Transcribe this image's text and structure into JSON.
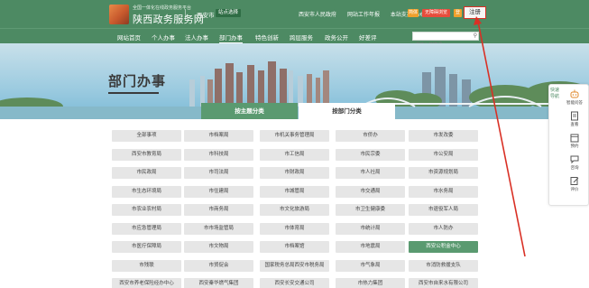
{
  "header": {
    "tagline": "全国一体化在线政务服务平台",
    "site_name": "陕西政务服务网",
    "city": "西安市",
    "switch_label": "站点选择",
    "top_links": [
      "西安市人民政府",
      "网站工作年报",
      "本站支持IPv6"
    ],
    "badge_a": "简体",
    "badge_b": "无障碍浏览",
    "badge_c": "登",
    "register_label": "注册"
  },
  "nav": {
    "items": [
      "网站首页",
      "个人办事",
      "法人办事",
      "部门办事",
      "特色创新",
      "跨层服务",
      "政务公开",
      "好差评"
    ],
    "active_index": 3,
    "search_placeholder": "请输入关键词"
  },
  "banner": {
    "title": "部门办事"
  },
  "tabs": {
    "theme": "按主题分类",
    "dept": "按部门分类",
    "active": "dept"
  },
  "categories": [
    [
      "全部事项",
      "市档案局",
      "市机关事务管理局",
      "市侨办",
      "市发改委"
    ],
    [
      "西安市教育局",
      "市科技局",
      "市工信局",
      "市民宗委",
      "市公安局"
    ],
    [
      "市民政局",
      "市司法局",
      "市财政局",
      "市人社局",
      "市资源规划局"
    ],
    [
      "市生态环境局",
      "市住建局",
      "市城管局",
      "市交通局",
      "市水务局"
    ],
    [
      "市农业农村局",
      "市商务局",
      "市文化旅游局",
      "市卫生健康委",
      "市退役军人局"
    ],
    [
      "市应急管理局",
      "市市场监管局",
      "市体育局",
      "市统计局",
      "市人防办"
    ],
    [
      "市医疗保障局",
      "市文物局",
      "市档案馆",
      "市地震局",
      "西安公积金中心"
    ],
    [
      "市残联",
      "市贸促会",
      "国家税务总局西安市税务局",
      "市气象局",
      "市消防救援支队"
    ],
    [
      "西安市养老保险经办中心",
      "西安秦华燃气集团",
      "西安长安交通公司",
      "市热力集团",
      "西安市自来水有限公司"
    ]
  ],
  "active_category": "西安公积金中心",
  "float_panel": {
    "label": "快速导航",
    "items": [
      "智能问答",
      "查看",
      "预约",
      "咨询",
      "评价"
    ]
  },
  "colors": {
    "brand_green": "#4d8a63",
    "active_green": "#5a9a70",
    "highlight_red": "#d93025"
  }
}
